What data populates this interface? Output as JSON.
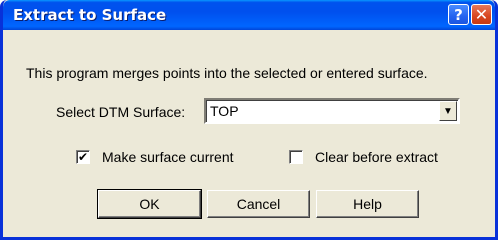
{
  "window": {
    "title": "Extract to Surface",
    "help_glyph": "?",
    "close_glyph": "✕"
  },
  "dialog": {
    "description": "This program merges points into the selected or entered surface.",
    "select_label": "Select DTM Surface:",
    "surface_value": "TOP",
    "dropdown_arrow": "▼",
    "make_current_label": "Make surface current",
    "make_current_checked": true,
    "make_current_mark": "✔",
    "clear_label": "Clear before extract",
    "clear_checked": false,
    "clear_mark": ""
  },
  "buttons": {
    "ok": "OK",
    "cancel": "Cancel",
    "help": "Help"
  },
  "colors": {
    "titlebar": "#0054e3",
    "close": "#d8461f",
    "face": "#ece9d8"
  }
}
